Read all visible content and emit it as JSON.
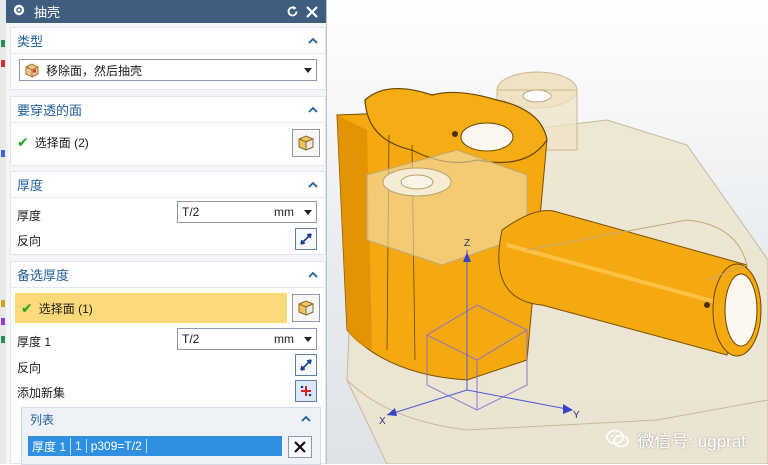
{
  "dialog": {
    "title": "抽壳",
    "type_group": {
      "label": "类型",
      "selected": "移除面，然后抽壳"
    },
    "pierce_group": {
      "label": "要穿透的面",
      "select_label": "选择面 (2)"
    },
    "thickness_group": {
      "label": "厚度",
      "thickness_label": "厚度",
      "thickness_value": "T/2",
      "thickness_unit": "mm",
      "reverse_label": "反向"
    },
    "alt_group": {
      "label": "备选厚度",
      "select_label": "选择面 (1)",
      "thickness_label": "厚度 1",
      "thickness_value": "T/2",
      "thickness_unit": "mm",
      "reverse_label": "反向",
      "add_set_label": "添加新集",
      "list": {
        "label": "列表",
        "row": {
          "name": "厚度 1",
          "index": "1",
          "expr": "p309=T/2"
        }
      }
    }
  },
  "viewport": {
    "axis_labels": {
      "x": "X",
      "y": "Y",
      "z": "Z"
    },
    "watermark": "微信号: ugprat"
  },
  "colors": {
    "title_bar": "#3f5e7f",
    "section_header": "#1f5f9b",
    "highlight_row": "#fcd979",
    "list_selection": "#2f8fe0",
    "model_orange": "#f5a911"
  }
}
